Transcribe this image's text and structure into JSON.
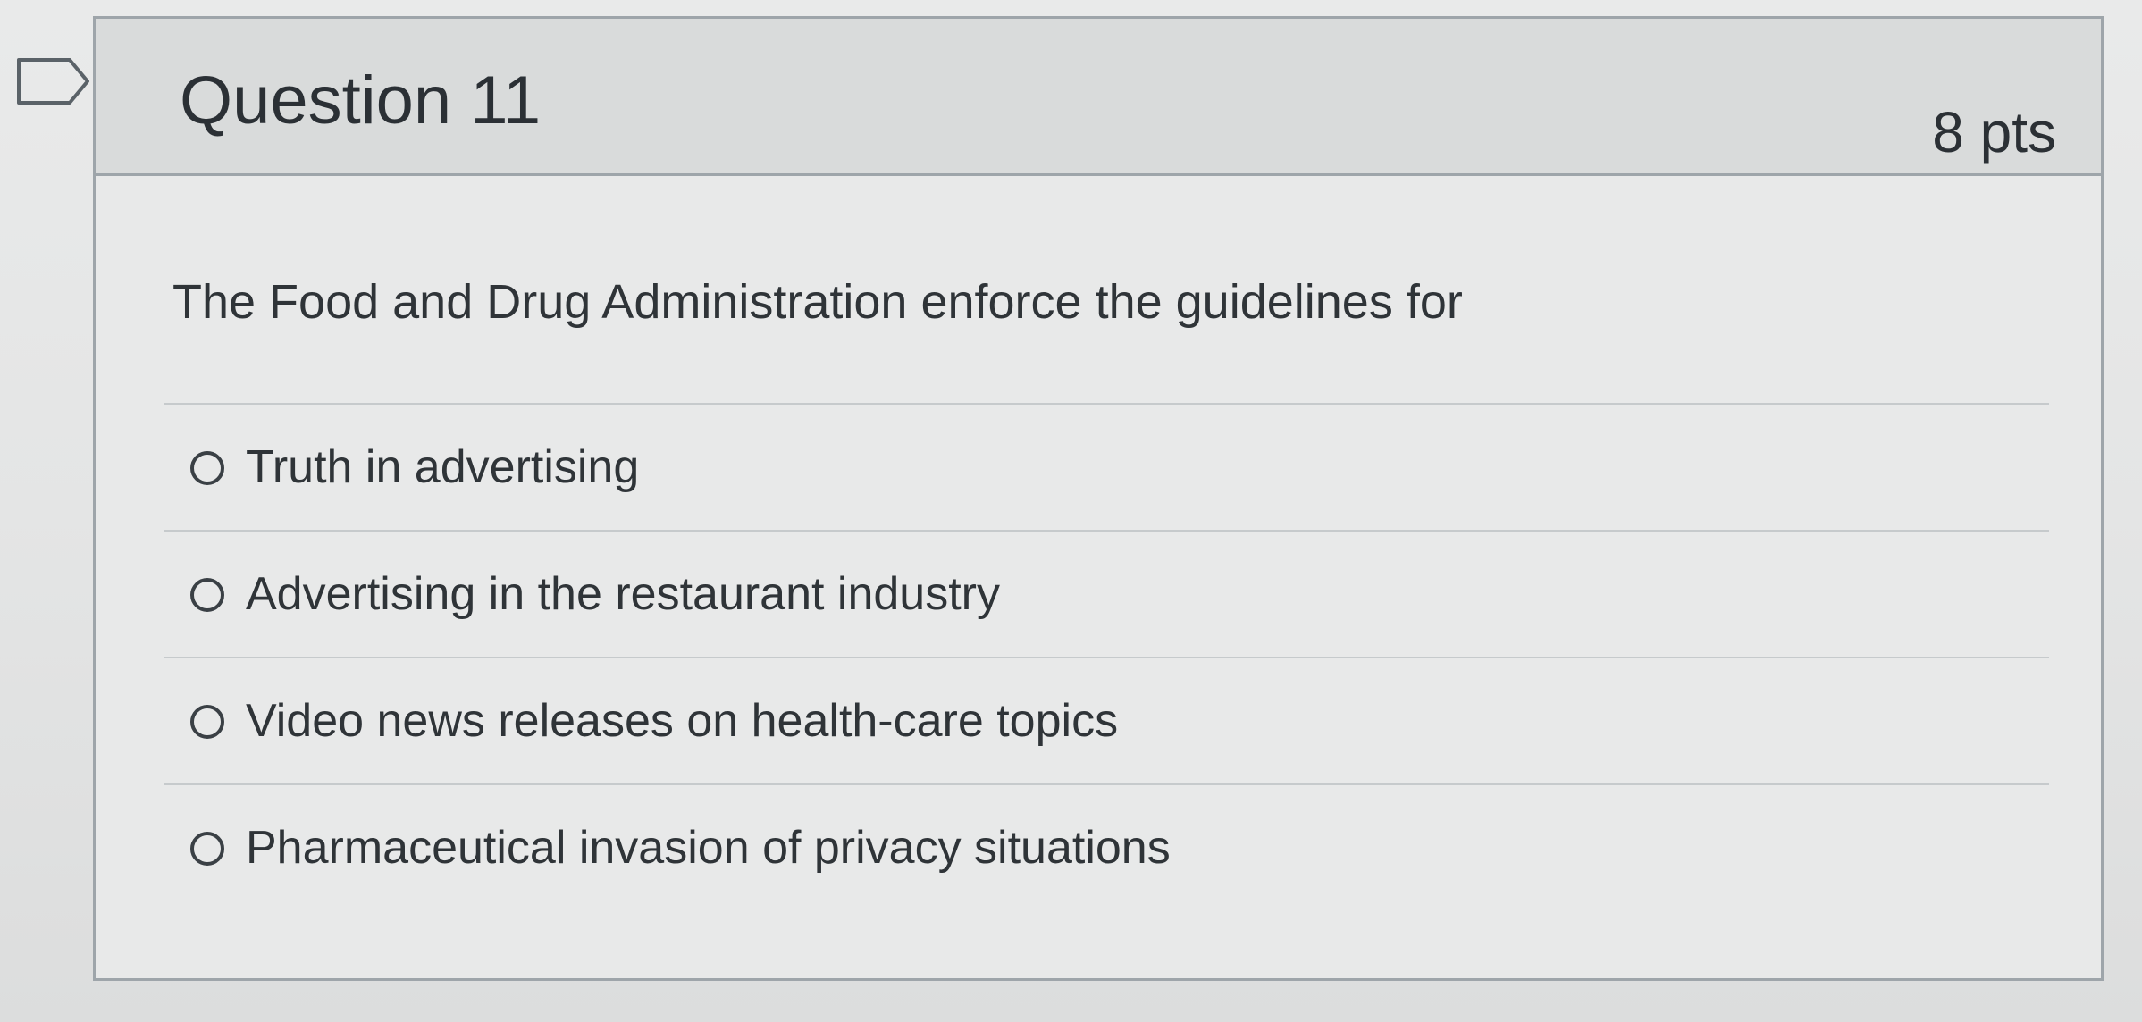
{
  "question": {
    "title": "Question 11",
    "points": "8 pts",
    "text": "The Food and Drug Administration enforce the guidelines for",
    "flag_icon": "flag-bookmark-icon",
    "answers": [
      {
        "label": "Truth in advertising",
        "selected": false
      },
      {
        "label": "Advertising in the restaurant industry",
        "selected": false
      },
      {
        "label": "Video news releases on health-care topics",
        "selected": false
      },
      {
        "label": "Pharmaceutical invasion of privacy situations",
        "selected": false
      }
    ]
  },
  "colors": {
    "header_bg": "#d9dbdb",
    "body_bg": "#e8e9e9",
    "border": "#9ea5aa",
    "text": "#2f3438"
  }
}
